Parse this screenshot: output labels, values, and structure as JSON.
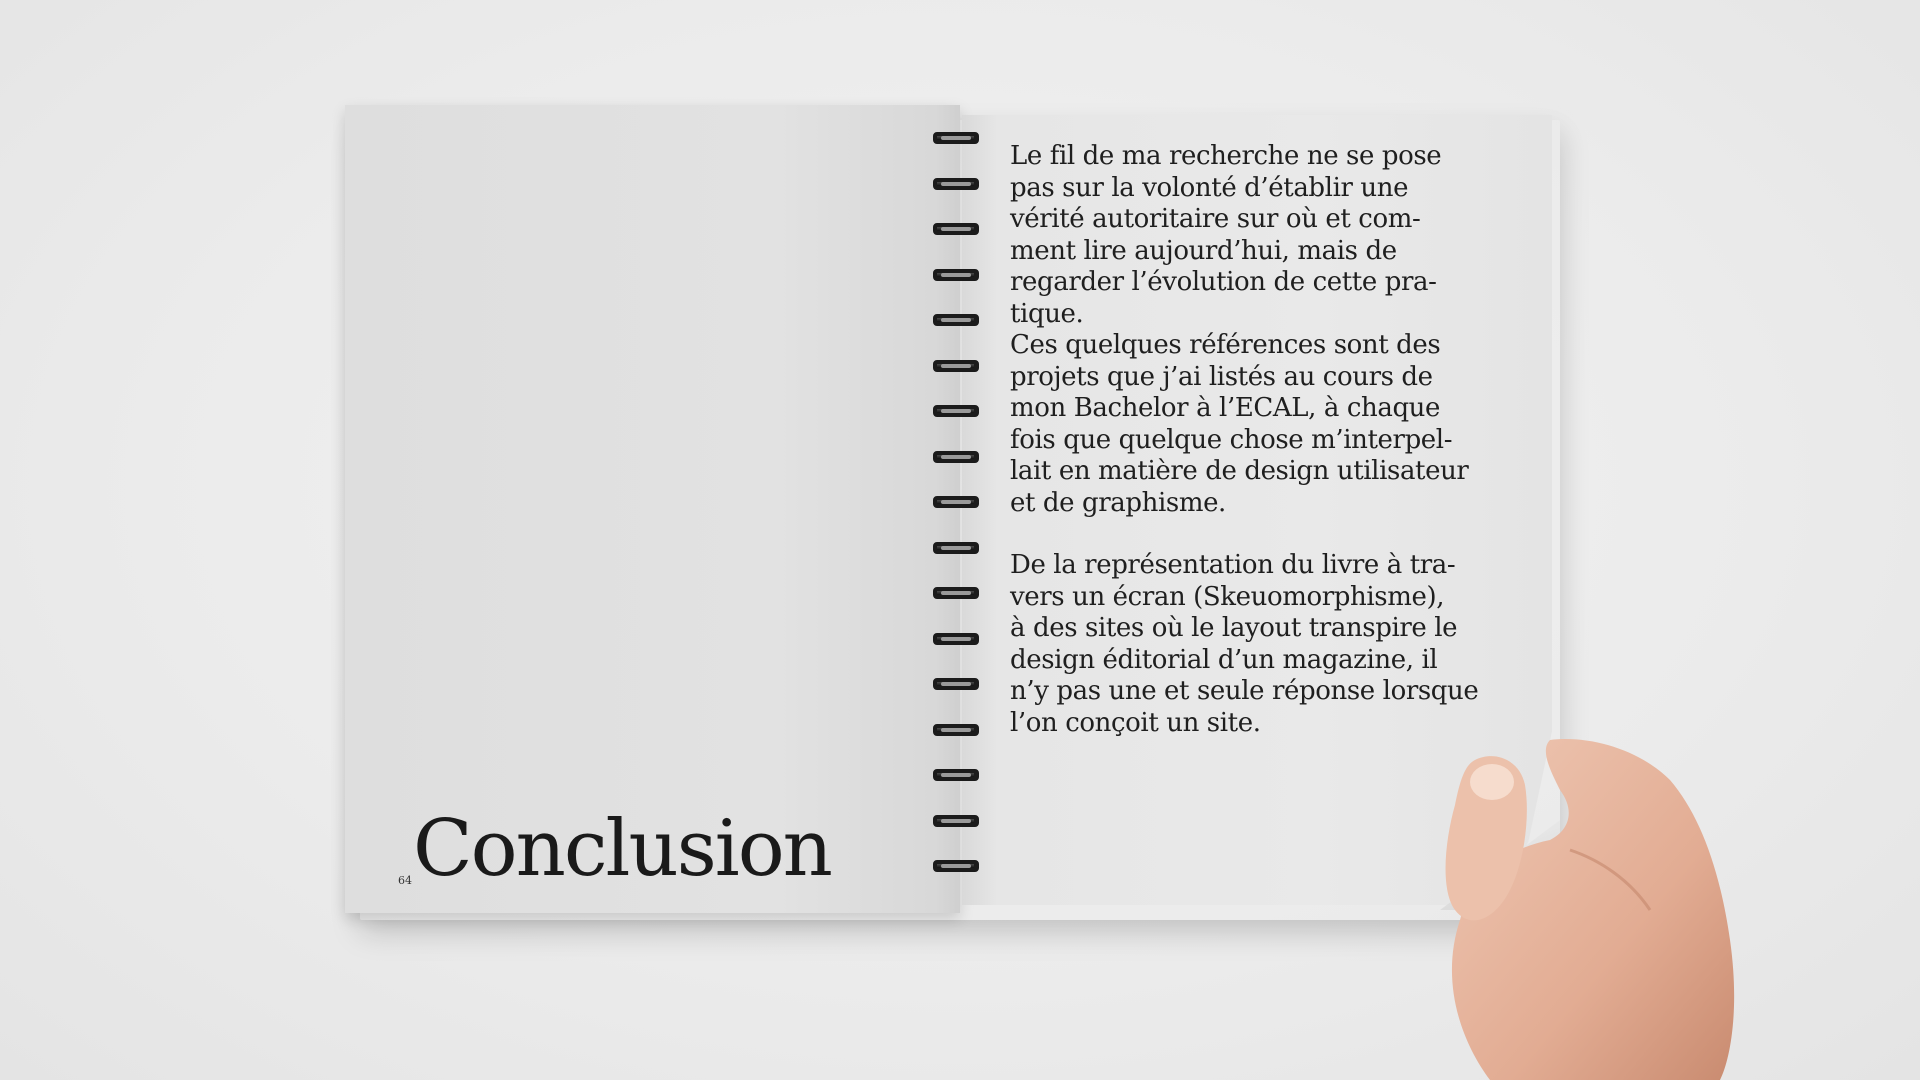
{
  "left_page": {
    "page_number": "64",
    "heading": "Conclusion"
  },
  "right_page": {
    "paragraph_1": [
      "Le fil de ma recherche ne se pose",
      "pas sur la volonté d’établir une",
      "vérité autoritaire sur où et com-",
      "ment lire aujourd’hui, mais de",
      "regarder l’évolution de cette pra-",
      "tique."
    ],
    "paragraph_2": [
      "Ces quelques références sont des",
      "projets que j’ai listés au cours de",
      "mon Bachelor à l’ECAL, à chaque",
      "fois que quelque chose m’interpel-",
      "lait en matière de design utilisateur",
      "et de graphisme."
    ],
    "paragraph_3": [
      "De la représentation du livre à tra-",
      "vers un écran (Skeuomorphisme),",
      "à des sites où le layout transpire le",
      "design éditorial d’un magazine, il",
      "n’y pas une et seule réponse lorsque",
      "l’on conçoit un site."
    ]
  },
  "binding": {
    "ring_count": 17,
    "ring_color": "#1b1b1b"
  },
  "colors": {
    "background": "#ececec",
    "paper": "#e4e4e4",
    "ink": "#1f1f1f"
  }
}
